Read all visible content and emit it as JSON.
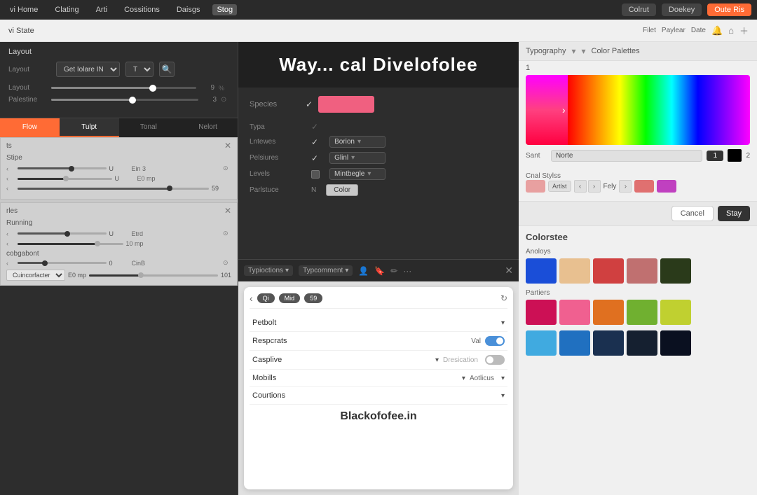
{
  "topNav": {
    "items": [
      "vi Home",
      "Clating",
      "Arti",
      "Cossitions",
      "Daisgs",
      "Stog"
    ],
    "activeItem": "Stog",
    "right": {
      "colrutLabel": "Colrut",
      "doekerLabel": "Doekey",
      "outeRisLabel": "Oute Ris"
    }
  },
  "pageSubheader": {
    "title": "vi State",
    "links": [
      "Filet",
      "Paylear",
      "Date"
    ],
    "icons": [
      "bell-icon",
      "home-icon",
      "plus-icon"
    ]
  },
  "leftPanel": {
    "sectionTitle": "Layout",
    "selectDefault": "Get Iolare IN",
    "selectOption": "Ties",
    "sliders": [
      {
        "label": "Layout",
        "value": 9,
        "unit": "%",
        "fillPct": 70
      },
      {
        "label": "Palestine",
        "value": 3,
        "unit": "",
        "fillPct": 55
      }
    ],
    "tabs": [
      "Flow",
      "Tulpt",
      "Tonal",
      "Nelort"
    ],
    "activeTab": "Tulpt"
  },
  "overlayTitle": {
    "text": "Way... cal Divelofolee"
  },
  "midPanel": {
    "rows": [
      {
        "label": "Species",
        "checked": true,
        "type": "swatch",
        "swatchColor": "#f06080"
      },
      {
        "label": "Typa",
        "checked": true,
        "type": "empty"
      },
      {
        "label": "Lntewes",
        "checked": true,
        "type": "dropdown",
        "value": "Borion"
      },
      {
        "label": "Pelsiures",
        "checked": true,
        "type": "dropdown",
        "value": "Glinl"
      },
      {
        "label": "Levels",
        "checked": false,
        "type": "dropdown",
        "value": "Mintbegle"
      },
      {
        "label": "Parlstuce",
        "checked": false,
        "type": "button",
        "value": "Color"
      }
    ],
    "toolbar": {
      "items": [
        "Typioctions",
        "Typcomment"
      ],
      "icons": [
        "person-icon",
        "bookmark-icon",
        "pen-icon"
      ]
    }
  },
  "devicePreview": {
    "tabs": [
      "Qi",
      "Mid",
      "59"
    ],
    "activeTab": "Mid",
    "settings": [
      {
        "label": "Petbolt",
        "type": "dropdown"
      },
      {
        "label": "Respcrats",
        "valueLabel": "Val",
        "type": "toggle-on"
      },
      {
        "label": "Casplive",
        "type": "dropdown",
        "rightLabel": "Dresication",
        "rightType": "toggle-off"
      },
      {
        "label": "Mobills",
        "type": "dropdown",
        "rightLabel": "Aotlicus",
        "rightType": "dropdown"
      },
      {
        "label": "Courtions",
        "type": "dropdown"
      }
    ],
    "footerText": "Blackofofee.in"
  },
  "bottomLeftPanels": [
    {
      "title": "ts",
      "subLabel": "Stipe",
      "sliders": [
        {
          "label": "",
          "value": "U",
          "extra": "Ein 3",
          "fillPct": 60,
          "dark": false
        },
        {
          "label": "",
          "value": "U",
          "extra": "E0 mp",
          "fillPct": 50,
          "dark": true
        },
        {
          "label": "",
          "value": "59",
          "extra": "",
          "fillPct": 80,
          "dark": false
        }
      ]
    },
    {
      "title": "rles",
      "subLabel": "Running",
      "sliders": [
        {
          "label": "",
          "value": "U",
          "extra": "Etrd",
          "fillPct": 55,
          "dark": false
        },
        {
          "label": "",
          "value": "",
          "extra": "10 mp",
          "fillPct": 75,
          "dark": true
        }
      ],
      "subLabel2": "cobgabont",
      "sliders2": [
        {
          "label": "",
          "value": "0",
          "extra": "CinB",
          "fillPct": 30,
          "dark": false
        }
      ],
      "inputRow": {
        "selectVal": "Cuincorfacter",
        "numVal": "E0 mp",
        "sliderVal": "101"
      }
    }
  ],
  "rightPanel": {
    "header": {
      "typographyLabel": "Typography",
      "colorPalettesLabel": "Color Palettes"
    },
    "numberLabel": "1",
    "gradientSection": {
      "pinkGradient": true,
      "rainbow": true
    },
    "controls": {
      "santLabel": "Sant",
      "santValue": "Norte",
      "num1": "1",
      "blackSwatch": "#000000",
      "num2": "2"
    },
    "charStyleLabel": "Cnal Stylss",
    "charStyles": [
      {
        "color": "#e8a0a0",
        "label": ""
      },
      {
        "color": "#c8c8c8",
        "label": "Artlst"
      }
    ],
    "navButtons": [
      "<",
      ">",
      "Fely",
      ">"
    ],
    "endSwatches": [
      "#e07070",
      "#c040c0"
    ],
    "actionBar": {
      "cancelLabel": "Cancel",
      "saveLabel": "Stay"
    }
  },
  "coloritee": {
    "title": "Colorstee",
    "groups": [
      {
        "label": "Anoloys",
        "swatches": [
          "#1a4ed8",
          "#e8c090",
          "#d04040",
          "#c07070",
          "#2a3a1a"
        ]
      },
      {
        "label": "Partiers",
        "swatches": [
          "#cc1055",
          "#f06090",
          "#e07020",
          "#70b030",
          "#c0d030"
        ]
      },
      {
        "label": "",
        "swatches": [
          "#40aae0",
          "#2070c0",
          "#1a3050",
          "#152030",
          "#0a1020"
        ]
      }
    ]
  }
}
